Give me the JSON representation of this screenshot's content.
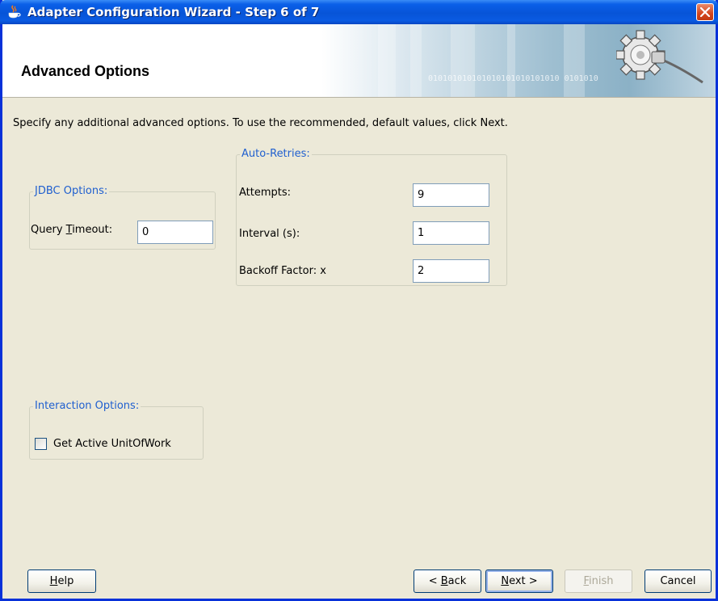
{
  "window": {
    "title": "Adapter Configuration Wizard - Step 6 of 7",
    "icon": "java-cup-icon",
    "close_icon": "close-icon"
  },
  "header": {
    "title": "Advanced Options",
    "binary_decoration": "010101010101010101010101010 0101010"
  },
  "instructions": "Specify any additional advanced options.  To use the recommended, default values, click Next.",
  "jdbc_options": {
    "legend": "JDBC Options:",
    "query_timeout_label_pre": "Query ",
    "query_timeout_label_mnemonic": "T",
    "query_timeout_label_post": "imeout:",
    "query_timeout_value": "0"
  },
  "auto_retries": {
    "legend": "Auto-Retries:",
    "attempts_label": "Attempts:",
    "attempts_value": "9",
    "interval_label": "Interval (s):",
    "interval_value": "1",
    "backoff_label": "Backoff Factor: x",
    "backoff_value": "2"
  },
  "interaction_options": {
    "legend": "Interaction Options:",
    "get_active_unit_of_work_label": "Get Active UnitOfWork",
    "get_active_unit_of_work_checked": false
  },
  "buttons": {
    "help_mnemonic": "H",
    "help_rest": "elp",
    "back_pre": "< ",
    "back_mnemonic": "B",
    "back_rest": "ack",
    "next_mnemonic": "N",
    "next_rest": "ext >",
    "finish_mnemonic": "F",
    "finish_rest": "inish",
    "cancel": "Cancel"
  },
  "colors": {
    "titlebar": "#0754d8",
    "window_bg": "#ece9d8",
    "legend_text": "#1f5fcf",
    "close_button": "#d4451c"
  }
}
